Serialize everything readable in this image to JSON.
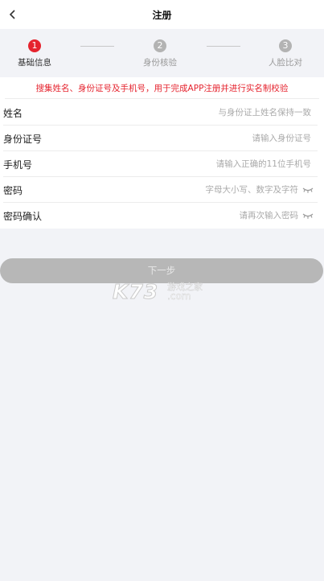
{
  "header": {
    "title": "注册",
    "back_icon": "chevron-left-icon"
  },
  "steps": [
    {
      "number": "1",
      "label": "基础信息",
      "active": true
    },
    {
      "number": "2",
      "label": "身份核验",
      "active": false
    },
    {
      "number": "3",
      "label": "人脸比对",
      "active": false
    }
  ],
  "form": {
    "notice": "搜集姓名、身份证号及手机号，用于完成APP注册并进行实名制校验",
    "fields": [
      {
        "label": "姓名",
        "value": "",
        "placeholder": "与身份证上姓名保持一致"
      },
      {
        "label": "身份证号",
        "value": "",
        "placeholder": "请输入身份证号"
      },
      {
        "label": "手机号",
        "value": "",
        "placeholder": "请输入正确的11位手机号"
      },
      {
        "label": "密码",
        "value": "",
        "placeholder": "字母大小写、数字及字符",
        "icon": "eye-closed-icon"
      },
      {
        "label": "密码确认",
        "value": "",
        "placeholder": "请再次输入密码",
        "icon": "eye-closed-icon"
      }
    ]
  },
  "next_button": {
    "label": "下一步"
  },
  "watermark": {
    "brand": "K73",
    "line1": "游戏之家",
    "line2": ".com"
  },
  "colors": {
    "accent": "#e5232e",
    "disabled_button": "#b7b7b7",
    "background": "#f2f3f7"
  }
}
